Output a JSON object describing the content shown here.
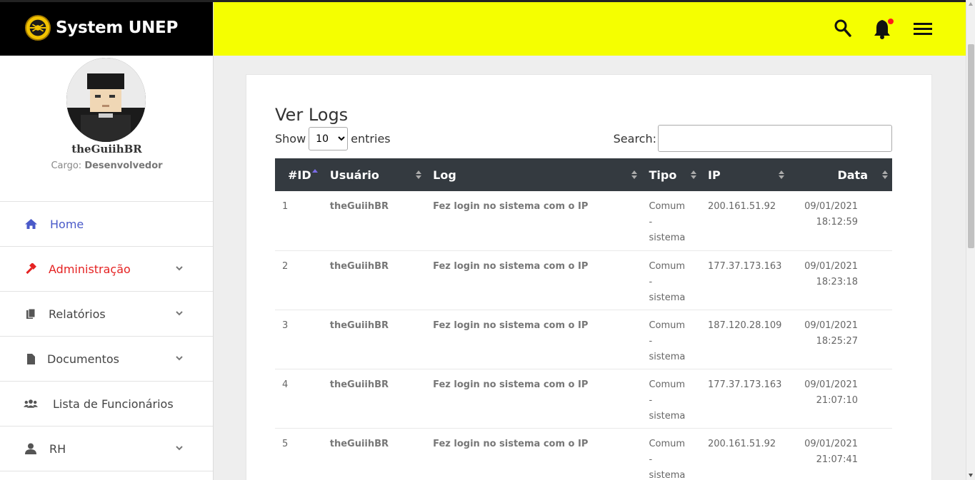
{
  "brand": {
    "name": "System UNEP"
  },
  "profile": {
    "username": "theGuiihBR",
    "cargo_label": "Cargo:",
    "cargo_value": "Desenvolvedor"
  },
  "sidebar": {
    "items": [
      {
        "label": "Home",
        "icon": "home-icon"
      },
      {
        "label": "Administração",
        "icon": "gavel-icon"
      },
      {
        "label": "Relatórios",
        "icon": "copy-icon"
      },
      {
        "label": "Documentos",
        "icon": "file-icon"
      },
      {
        "label": "Lista de Funcionários",
        "icon": "users-icon"
      },
      {
        "label": "RH",
        "icon": "user-icon"
      }
    ]
  },
  "header": {
    "icons": [
      "search-icon",
      "bell-icon",
      "menu-icon"
    ]
  },
  "page": {
    "title": "Ver Logs",
    "show_label": "Show",
    "entries_label": "entries",
    "entries_value": "10",
    "search_label": "Search:",
    "search_value": ""
  },
  "table": {
    "columns": [
      "#ID",
      "Usuário",
      "Log",
      "Tipo",
      "IP",
      "Data"
    ],
    "rows": [
      {
        "id": "1",
        "usuario": "theGuiihBR",
        "log": "Fez login no sistema com o IP",
        "tipo": [
          "Comum",
          "-",
          "sistema"
        ],
        "ip": "200.161.51.92",
        "data": [
          "09/01/2021",
          "18:12:59"
        ]
      },
      {
        "id": "2",
        "usuario": "theGuiihBR",
        "log": "Fez login no sistema com o IP",
        "tipo": [
          "Comum",
          "-",
          "sistema"
        ],
        "ip": "177.37.173.163",
        "data": [
          "09/01/2021",
          "18:23:18"
        ]
      },
      {
        "id": "3",
        "usuario": "theGuiihBR",
        "log": "Fez login no sistema com o IP",
        "tipo": [
          "Comum",
          "-",
          "sistema"
        ],
        "ip": "187.120.28.109",
        "data": [
          "09/01/2021",
          "18:25:27"
        ]
      },
      {
        "id": "4",
        "usuario": "theGuiihBR",
        "log": "Fez login no sistema com o IP",
        "tipo": [
          "Comum",
          "-",
          "sistema"
        ],
        "ip": "177.37.173.163",
        "data": [
          "09/01/2021",
          "21:07:10"
        ]
      },
      {
        "id": "5",
        "usuario": "theGuiihBR",
        "log": "Fez login no sistema com o IP",
        "tipo": [
          "Comum",
          "-",
          "sistema"
        ],
        "ip": "200.161.51.92",
        "data": [
          "09/01/2021",
          "21:07:41"
        ]
      }
    ]
  },
  "colors": {
    "header_bg": "#f5ff00",
    "brand_bg": "#000000",
    "active": "#4a5ac9",
    "admin": "#e52222",
    "table_head": "#343a40"
  }
}
